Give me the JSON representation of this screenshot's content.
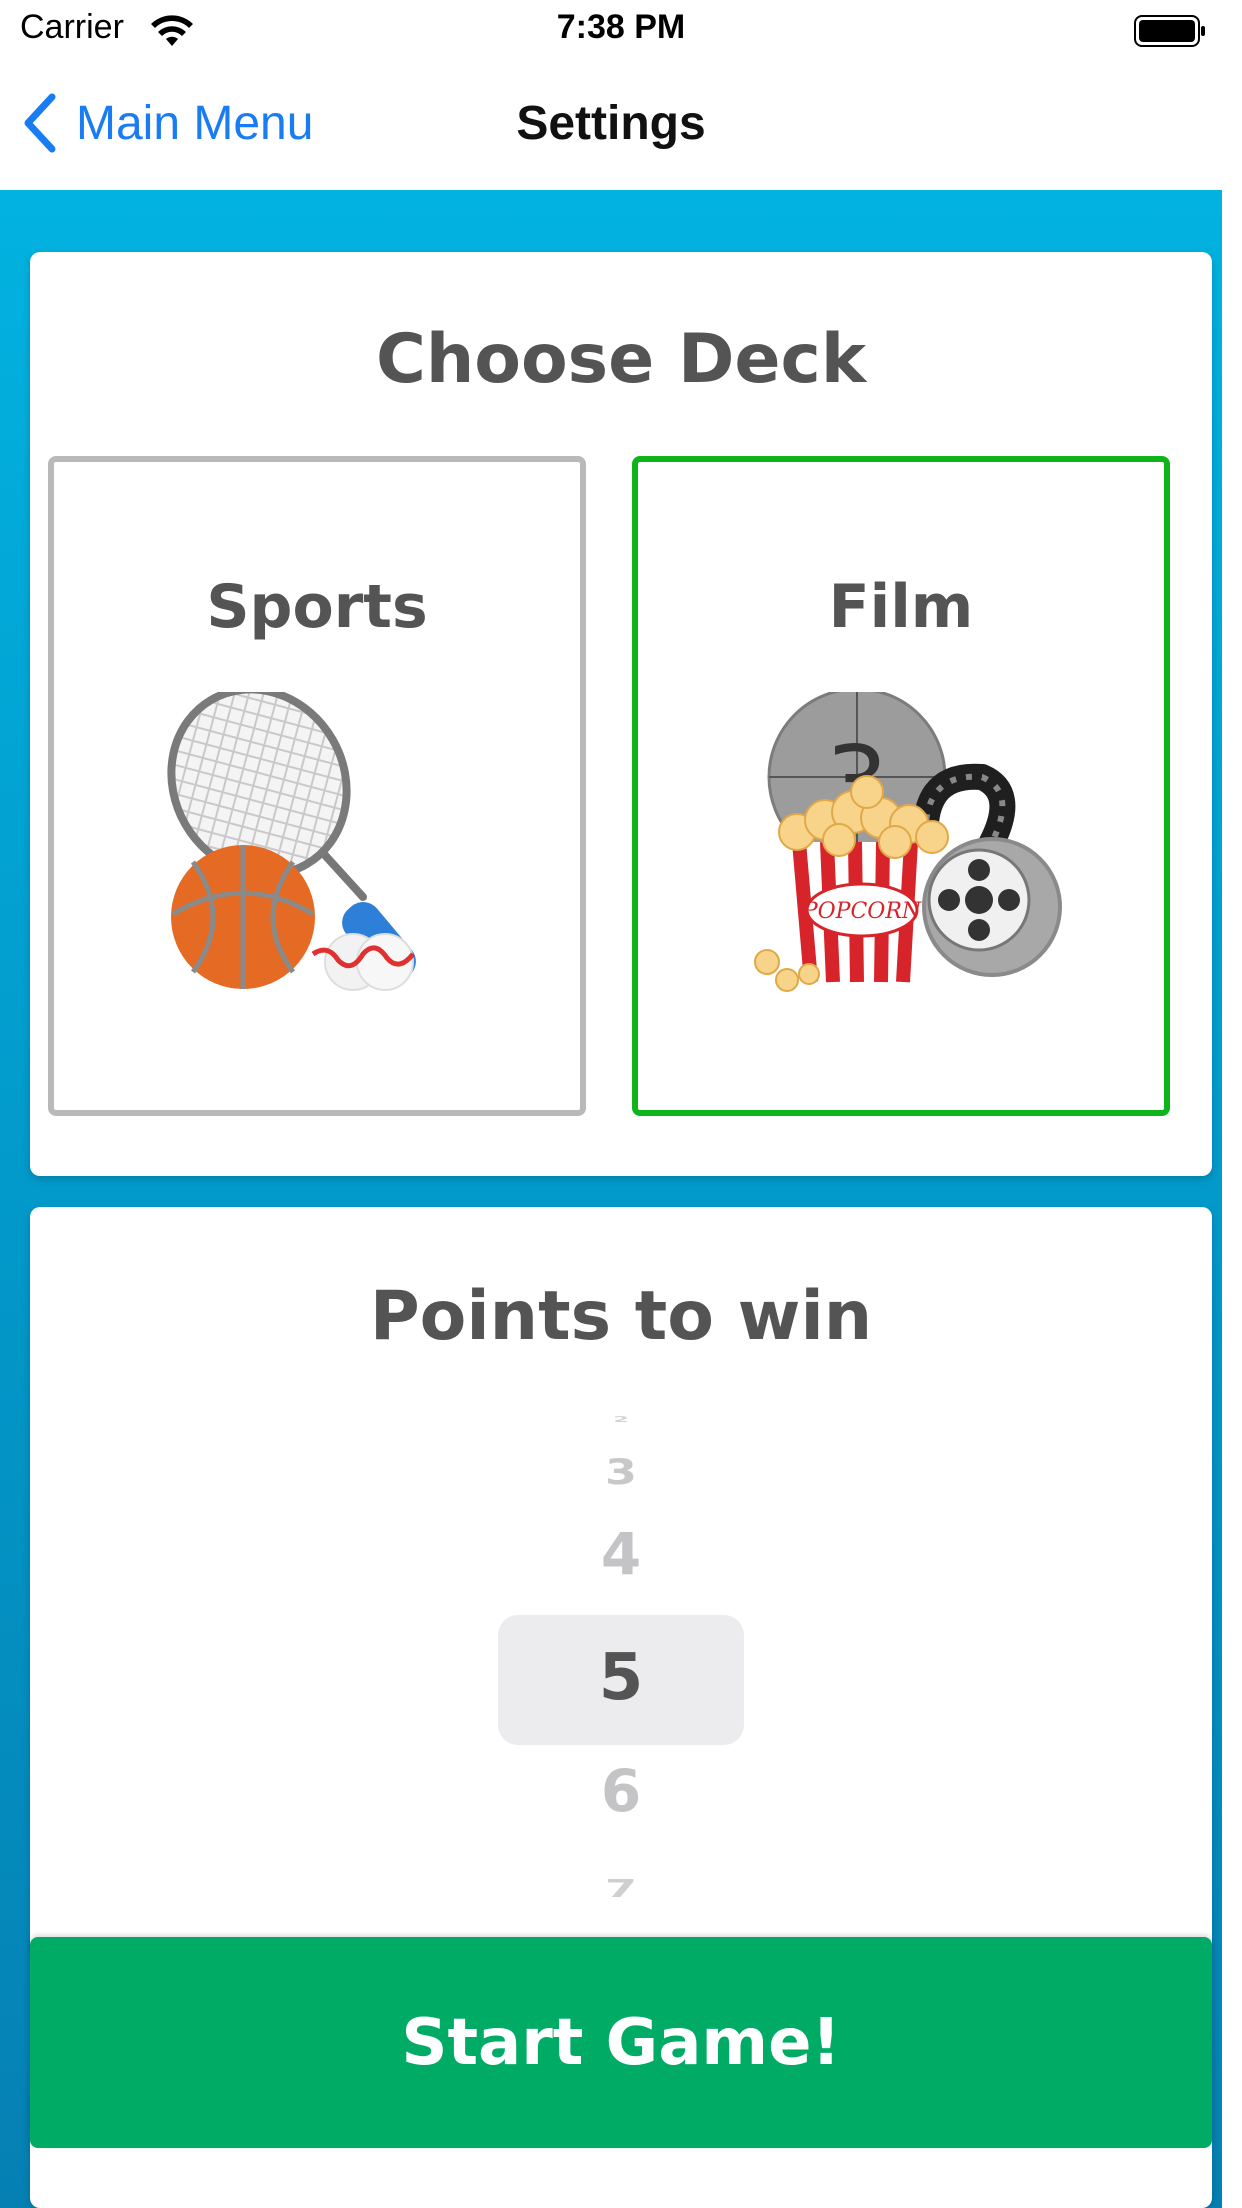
{
  "status_bar": {
    "carrier": "Carrier",
    "time": "7:38 PM",
    "wifi_icon": "wifi-icon",
    "battery_icon": "battery-icon"
  },
  "nav": {
    "back_label": "Main Menu",
    "back_icon": "chevron-left-icon",
    "title": "Settings"
  },
  "deck_section": {
    "title": "Choose Deck",
    "options": [
      {
        "label": "Sports",
        "icon": "sports-equipment-icon",
        "selected": false
      },
      {
        "label": "Film",
        "icon": "film-popcorn-icon",
        "selected": true,
        "popcorn_text": "POPCORN",
        "countdown_digit": "3"
      }
    ]
  },
  "points_section": {
    "title": "Points to win",
    "picker_values": [
      "2",
      "3",
      "4",
      "5",
      "6",
      "7"
    ],
    "selected_value": "5"
  },
  "start_button": {
    "label": "Start Game!"
  },
  "colors": {
    "accent_blue": "#1a7cf2",
    "background_gradient_top": "#02b2e0",
    "background_gradient_bottom": "#0680b3",
    "selected_border": "#0eb41a",
    "unselected_border": "#b9b9b9",
    "start_button": "#00ab66",
    "title_text": "#545454"
  }
}
